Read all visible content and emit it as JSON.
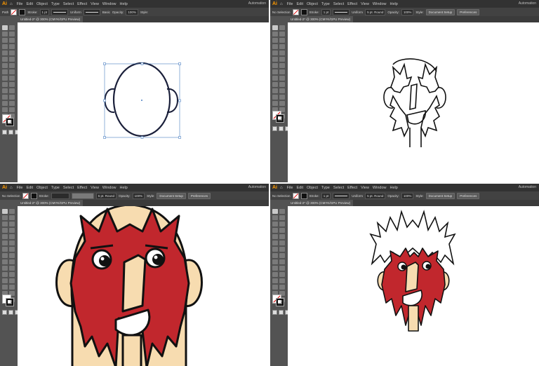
{
  "menu": {
    "logo": "Ai",
    "home_icon": "home-icon",
    "items": [
      "File",
      "Edit",
      "Object",
      "Type",
      "Select",
      "Effect",
      "View",
      "Window",
      "Help"
    ],
    "workspace": "Automation"
  },
  "panels": [
    {
      "control": {
        "selection": "Path",
        "stroke_label": "Stroke:",
        "stroke_weight": "1 pt",
        "profile": "Uniform",
        "brush": "Basic",
        "opacity_label": "Opacity:",
        "opacity": "100%",
        "style_label": "Style:",
        "setup_button": "",
        "prefs_button": ""
      },
      "tab": "Untitled-2* @ 300% (CMYK/GPU Preview)"
    },
    {
      "control": {
        "selection": "No Selection",
        "stroke_label": "Stroke:",
        "stroke_weight": "1 pt",
        "profile": "Uniform",
        "brush": "5 pt. Round",
        "opacity_label": "Opacity:",
        "opacity": "100%",
        "style_label": "Style:",
        "setup_button": "Document Setup",
        "prefs_button": "Preferences"
      },
      "tab": "Untitled-2* @ 300% (CMYK/GPU Preview)"
    },
    {
      "control": {
        "selection": "No Selection",
        "stroke_label": "Stroke:",
        "stroke_weight": "",
        "profile": "",
        "brush": "5 pt. Round",
        "opacity_label": "Opacity:",
        "opacity": "100%",
        "style_label": "Style:",
        "setup_button": "Document Setup",
        "prefs_button": "Preferences"
      },
      "tab": "Untitled-2* @ 300% (CMYK/GPU Preview)"
    },
    {
      "control": {
        "selection": "No Selection",
        "stroke_label": "Stroke:",
        "stroke_weight": "1 pt",
        "profile": "Uniform",
        "brush": "5 pt. Round",
        "opacity_label": "Opacity:",
        "opacity": "100%",
        "style_label": "Style:",
        "setup_button": "Document Setup",
        "prefs_button": "Preferences"
      },
      "tab": "Untitled-2* @ 300% (CMYK/GPU Preview)"
    }
  ],
  "colors": {
    "skin": "#f7dcb0",
    "red": "#c1272d",
    "outline": "#111111",
    "selection": "#4a7fc1",
    "ai_orange": "#ff9a00"
  }
}
